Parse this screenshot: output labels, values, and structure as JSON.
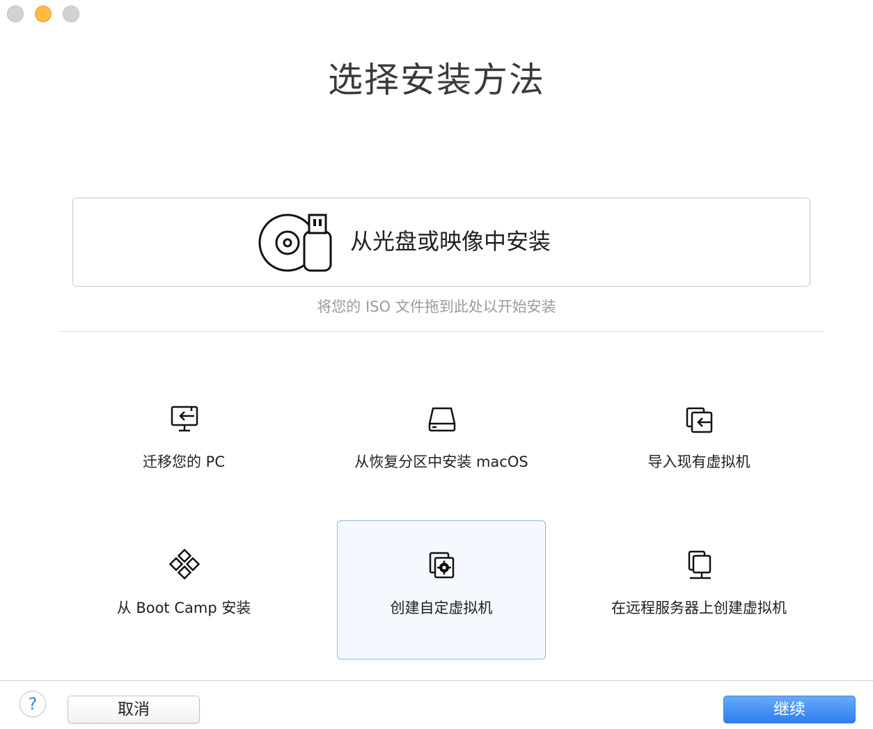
{
  "window": {
    "traffic_lights": [
      "close",
      "minimize",
      "zoom"
    ],
    "title": "选择安装方法"
  },
  "dropzone": {
    "icon": "disc-usb-icon",
    "label": "从光盘或映像中安装",
    "hint": "将您的 ISO 文件拖到此处以开始安装"
  },
  "options": [
    {
      "label": "迁移您的 PC",
      "icon": "migrate-pc-icon",
      "selected": false
    },
    {
      "label": "从恢复分区中安装 macOS",
      "icon": "hard-drive-icon",
      "selected": false
    },
    {
      "label": "导入现有虚拟机",
      "icon": "import-vm-icon",
      "selected": false
    },
    {
      "label": "从 Boot Camp 安装",
      "icon": "boot-camp-icon",
      "selected": false
    },
    {
      "label": "创建自定虚拟机",
      "icon": "custom-vm-icon",
      "selected": true
    },
    {
      "label": "在远程服务器上创建虚拟机",
      "icon": "remote-server-icon",
      "selected": false
    }
  ],
  "footer": {
    "help_label": "?",
    "cancel_label": "取消",
    "continue_label": "继续"
  },
  "colors": {
    "accent": "#2d7ef0",
    "selected_bg": "#f5f8fe",
    "selected_border": "#8fb6ec",
    "hint_text": "#9a9a9a"
  }
}
